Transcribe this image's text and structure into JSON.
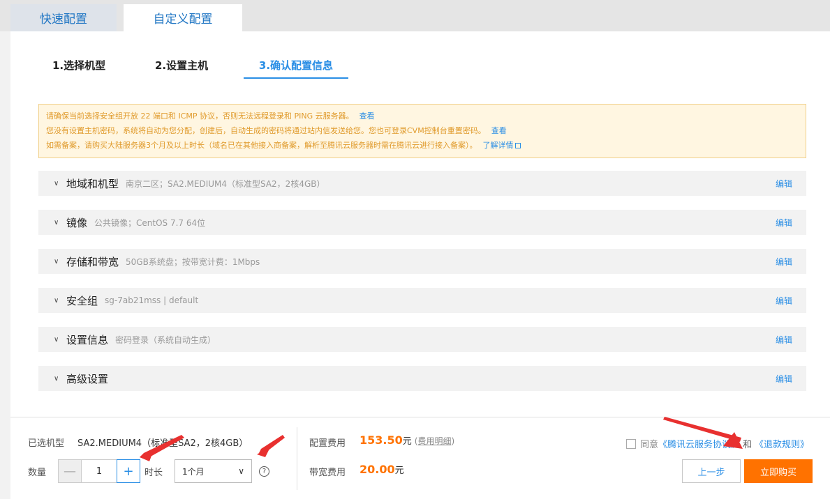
{
  "top_tabs": [
    {
      "label": "快速配置"
    },
    {
      "label": "自定义配置"
    }
  ],
  "steps": [
    {
      "label": "1.选择机型"
    },
    {
      "label": "2.设置主机"
    },
    {
      "label": "3.确认配置信息"
    }
  ],
  "notice": {
    "line1": "请确保当前选择安全组开放 22 端口和 ICMP 协议，否则无法远程登录和 PING 云服务器。",
    "line1_link": "查看",
    "line2": "您没有设置主机密码，系统将自动为您分配，创建后，自动生成的密码将通过站内信发送给您。您也可登录CVM控制台重置密码。",
    "line2_link": "查看",
    "line3": "如需备案，请购买大陆服务器3个月及以上时长（域名已在其他接入商备案，解析至腾讯云服务器时需在腾讯云进行接入备案）。",
    "line3_link": "了解详情"
  },
  "rows": [
    {
      "title": "地域和机型",
      "desc": "南京二区；SA2.MEDIUM4（标准型SA2，2核4GB）",
      "edit": "编辑"
    },
    {
      "title": "镜像",
      "desc": "公共镜像；CentOS 7.7 64位",
      "edit": "编辑"
    },
    {
      "title": "存储和带宽",
      "desc": "50GB系统盘；按带宽计费：1Mbps",
      "edit": "编辑"
    },
    {
      "title": "安全组",
      "desc": "sg-7ab21mss | default",
      "edit": "编辑"
    },
    {
      "title": "设置信息",
      "desc": "密码登录（系统自动生成）",
      "edit": "编辑"
    },
    {
      "title": "高级设置",
      "desc": "",
      "edit": "编辑"
    }
  ],
  "footer": {
    "model_label": "已选机型",
    "model_value": "SA2.MEDIUM4（标准型SA2，2核4GB）",
    "qty_label": "数量",
    "qty_minus": "—",
    "qty_value": "1",
    "qty_plus": "+",
    "duration_label": "时长",
    "duration_value": "1个月",
    "help": "?",
    "config_fee_label": "配置费用",
    "config_fee_value": "153.50",
    "fee_unit": "元",
    "fee_detail": "费用明细",
    "bandwidth_fee_label": "带宽费用",
    "bandwidth_fee_value": "20.00",
    "agree_text": "同意",
    "agree_link1": "《腾讯云服务协议》",
    "agree_and": "和",
    "agree_link2": "《退款规则》",
    "prev_button": "上一步",
    "buy_button": "立即购买"
  },
  "colors": {
    "accent": "#2a8ee5",
    "orange": "#ff7200",
    "arrow_red": "#e8302f",
    "notice_bg": "#fff6e1"
  }
}
